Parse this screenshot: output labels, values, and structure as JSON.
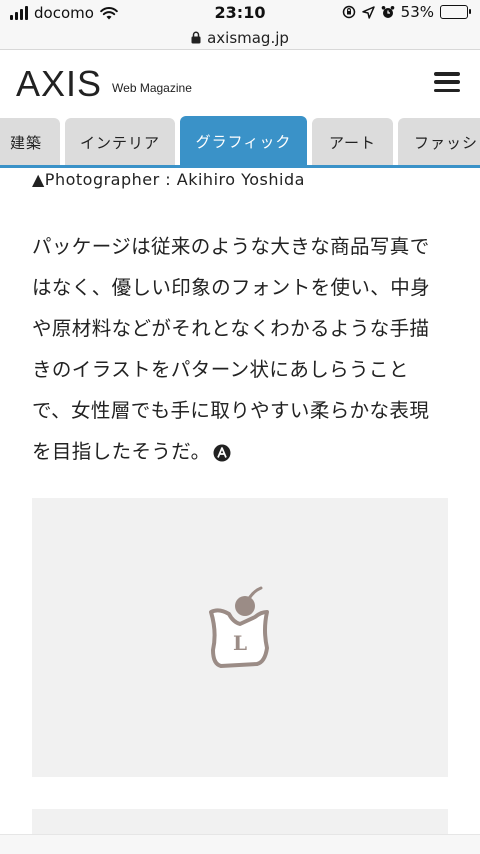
{
  "status_bar": {
    "carrier": "docomo",
    "time": "23:10",
    "battery": "53%",
    "battery_level": 0.53
  },
  "browser": {
    "url": "axismag.jp"
  },
  "site": {
    "logo": "AXIS",
    "logo_sub": "Web Magazine"
  },
  "tabs": [
    {
      "label": "建築",
      "active": false
    },
    {
      "label": "インテリア",
      "active": false
    },
    {
      "label": "グラフィック",
      "active": true
    },
    {
      "label": "アート",
      "active": false
    },
    {
      "label": "ファッシ",
      "active": false
    }
  ],
  "article": {
    "caption": "▲Photographer : Akihiro Yoshida",
    "lines": [
      "パッケージは従来のような大きな商品写真で",
      "はなく、優しい印象のフォントを使い、中身",
      "や原材料などがそれとなくわかるような手描",
      "きのイラストをパターン状にあしらうこと",
      "で、女性層でも手に取りやすい柔らかな表現",
      "を目指したそうだ。"
    ],
    "image_logo_letter": "L"
  },
  "colors": {
    "accent": "#3a92c8",
    "tab_inactive": "#dcdcdc",
    "placeholder": "#f1f1f1",
    "logo_icon": "#9b8c86"
  }
}
